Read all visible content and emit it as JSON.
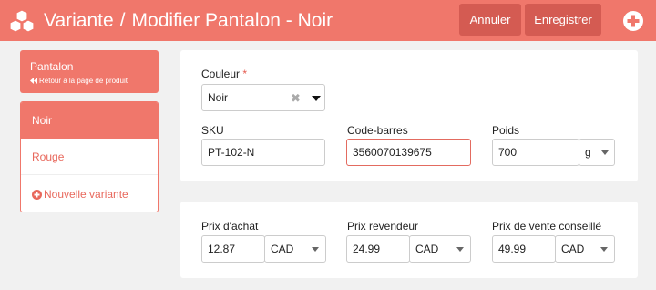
{
  "header": {
    "section": "Variante",
    "separator": "/",
    "page_title": "Modifier Pantalon - Noir",
    "cancel_label": "Annuler",
    "save_label": "Enregistrer"
  },
  "sidebar": {
    "product_name": "Pantalon",
    "back_label": "Retour à la page de produit",
    "variants": [
      {
        "label": "Noir",
        "active": true
      },
      {
        "label": "Rouge",
        "active": false
      }
    ],
    "add_variant_label": "Nouvelle variante"
  },
  "form": {
    "color": {
      "label": "Couleur",
      "required_mark": "*",
      "value": "Noir"
    },
    "sku": {
      "label": "SKU",
      "value": "PT-102-N"
    },
    "barcode": {
      "label": "Code-barres",
      "value": "3560070139675"
    },
    "weight": {
      "label": "Poids",
      "value": "700",
      "unit": "g"
    },
    "purchase_price": {
      "label": "Prix d'achat",
      "value": "12.87",
      "currency": "CAD"
    },
    "reseller_price": {
      "label": "Prix revendeur",
      "value": "24.99",
      "currency": "CAD"
    },
    "retail_price": {
      "label": "Prix de vente conseillé",
      "value": "49.99",
      "currency": "CAD"
    }
  },
  "colors": {
    "accent": "#f0776b",
    "button_dark": "#d45b52",
    "error_border": "#e36b60",
    "page_bg": "#f1f1f1"
  },
  "icons": [
    "cubes-logo-icon",
    "plus-circle-icon",
    "double-chevron-left-icon",
    "plus-circle-small-icon",
    "clear-icon",
    "chevron-down-icon"
  ]
}
